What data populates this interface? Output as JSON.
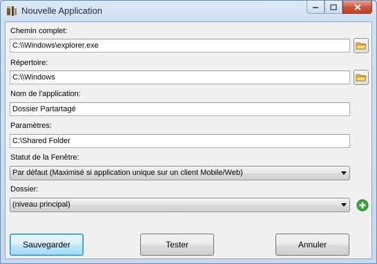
{
  "window": {
    "title": "Nouvelle Application"
  },
  "fields": {
    "chemin": {
      "label": "Chemin complet:",
      "value": "C:\\\\Windows\\explorer.exe"
    },
    "repertoire": {
      "label": "Répertoire:",
      "value": "C:\\\\Windows"
    },
    "nom": {
      "label": "Nom de l'application:",
      "value": "Dossier Partartagé"
    },
    "parametres": {
      "label": "Paramètres:",
      "value": "C:\\Shared Folder"
    },
    "statut": {
      "label": "Statut de la Fenêtre:",
      "value": "Par défaut (Maximisé si application unique sur un client Mobile/Web)"
    },
    "dossier": {
      "label": "Dossier:",
      "value": "(niveau principal)"
    }
  },
  "buttons": {
    "save": "Sauvegarder",
    "test": "Tester",
    "cancel": "Annuler"
  },
  "icons": {
    "app": "application-icon",
    "folder": "folder-icon",
    "add": "add-icon"
  },
  "colors": {
    "add_green": "#3aa640",
    "folder_yellow": "#e8c14a"
  }
}
